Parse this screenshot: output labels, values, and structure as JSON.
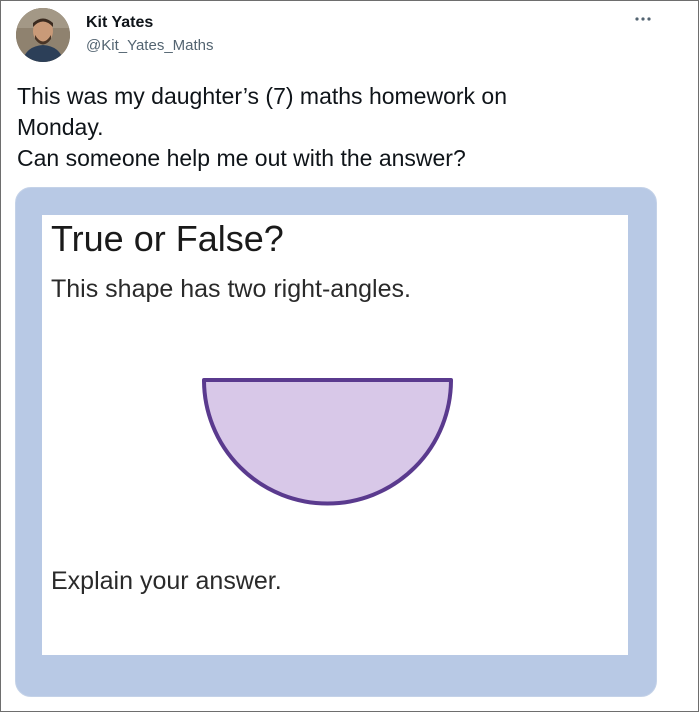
{
  "tweet": {
    "author_name": "Kit Yates",
    "author_handle": "@Kit_Yates_Maths",
    "more_icon": "more-horizontal-icon",
    "text_lines": [
      "This was my daughter’s (7) maths homework on",
      "Monday.",
      "Can someone help me out with the answer?"
    ]
  },
  "media": {
    "title": "True or False?",
    "statement": "This shape has two right-angles.",
    "prompt": "Explain your answer.",
    "shape_icon": "semicircle-shape",
    "colors": {
      "frame_background": "#b8c9e5",
      "shape_fill": "#d8c8e8",
      "shape_stroke": "#5a3a8e"
    }
  }
}
